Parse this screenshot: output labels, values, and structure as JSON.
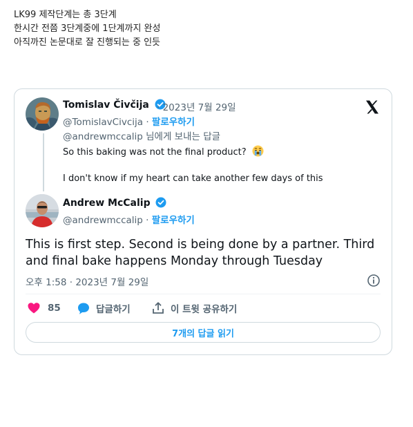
{
  "post": {
    "lines": [
      "LK99 제작단계는 총 3단계",
      "한시간 전쯤 3단계중에 1단계까지 완성",
      "아직까진 논문대로 잘 진행되는 중 인듯"
    ]
  },
  "tweet": {
    "parent": {
      "name": "Tomislav Čivčija",
      "date": "· 2023년 7월 29일",
      "handle": "@TomislavCivcija",
      "sep": "·",
      "follow": "팔로우하기",
      "reply_to_handle": "@andrewmccalip",
      "reply_to_suffix": " 님에게 보내는 답글",
      "text1": "So this baking was not the final product?",
      "text2": "I don't know if my heart can take another few days of this"
    },
    "main": {
      "name": "Andrew McCalip",
      "handle": "@andrewmccalip",
      "sep": "·",
      "follow": "팔로우하기",
      "text_lines": [
        "This is first step. Second is being done by a partner. Third",
        "and final bake happens Monday through Tuesday"
      ],
      "timestamp": "오후 1:58 · 2023년 7월 29일"
    },
    "actions": {
      "likes": "85",
      "reply_label": "답글하기",
      "share_label": "이 트윗 공유하기"
    },
    "read_replies": "7개의 답글 읽기"
  },
  "colors": {
    "accent": "#1d9bf0",
    "like": "#f91880",
    "secondary_text": "#536471",
    "border": "#cfd9de"
  }
}
